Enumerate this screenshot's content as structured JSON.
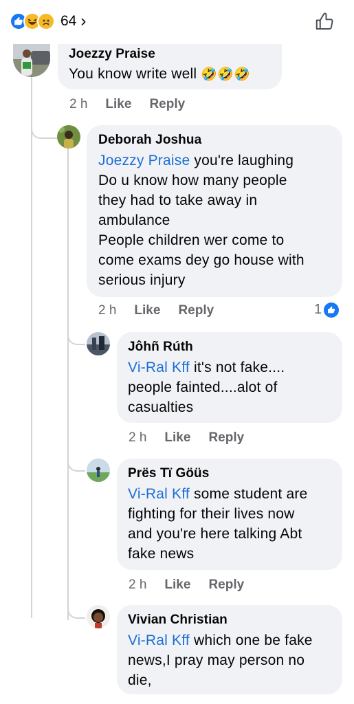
{
  "post_reactions": {
    "count": "64",
    "icons": [
      "like-icon",
      "haha-icon",
      "sad-icon"
    ],
    "chevron": "›"
  },
  "comments": [
    {
      "author": "Joezzy Praise",
      "text": "You know write well",
      "emoji": "🤣🤣🤣",
      "time": "2 h",
      "like": "Like",
      "reply": "Reply"
    },
    {
      "author": "Deborah Joshua",
      "mention": "Joezzy Praise",
      "text_lines": [
        " you're laughing",
        "Do u know how many people",
        "they had to take away in",
        "ambulance",
        "People children wer come to",
        "come exams dey go house with",
        "serious injury"
      ],
      "time": "2 h",
      "like": "Like",
      "reply": "Reply",
      "reaction_count": "1"
    },
    {
      "author": "Jôhñ Rúth",
      "mention": "Vi-Ral Kff",
      "text_lines": [
        " it's not fake....",
        "people fainted....alot of",
        "casualties"
      ],
      "time": "2 h",
      "like": "Like",
      "reply": "Reply"
    },
    {
      "author": "Prës Tï Göüs",
      "mention": "Vi-Ral Kff",
      "text_lines": [
        " some student are",
        "fighting for their lives now",
        "and you're here talking Abt",
        "fake news"
      ],
      "time": "2 h",
      "like": "Like",
      "reply": "Reply"
    },
    {
      "author": "Vivian Christian",
      "mention": "Vi-Ral Kff",
      "text_lines": [
        " which one be fake",
        "news,I pray may person no",
        "die,"
      ]
    }
  ],
  "colors": {
    "mention": "#1c6fd4",
    "bubble": "#f0f2f5",
    "meta": "#65676b",
    "like_blue": "#1877f2"
  }
}
